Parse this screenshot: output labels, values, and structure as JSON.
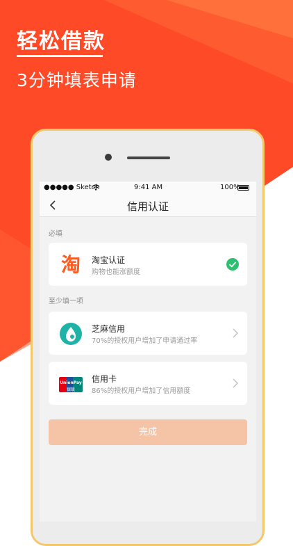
{
  "promo": {
    "headline": "轻松借款",
    "subline": "3分钟填表申请"
  },
  "status_bar": {
    "carrier": "●●●●● Sketch",
    "time": "9:41 AM",
    "battery": "100%"
  },
  "nav": {
    "title": "信用认证"
  },
  "sections": {
    "required_label": "必填",
    "optional_label": "至少填一项"
  },
  "cards": {
    "taobao": {
      "title": "淘宝认证",
      "subtitle": "购物也能涨额度",
      "icon_glyph": "淘",
      "verified": true
    },
    "zhima": {
      "title": "芝麻信用",
      "subtitle": "70%的授权用户增加了申请通过率"
    },
    "credit_card": {
      "title": "信用卡",
      "subtitle": "86%的授权用户增加了信用額度",
      "logo_text": "UnionPay",
      "logo_cn": "银联"
    }
  },
  "done_button": "完成",
  "colors": {
    "brand_red": "#ff4d2d",
    "accent_orange": "#ff7a3a",
    "check_green": "#2fbf71",
    "zhima_teal": "#1fb2a6"
  }
}
